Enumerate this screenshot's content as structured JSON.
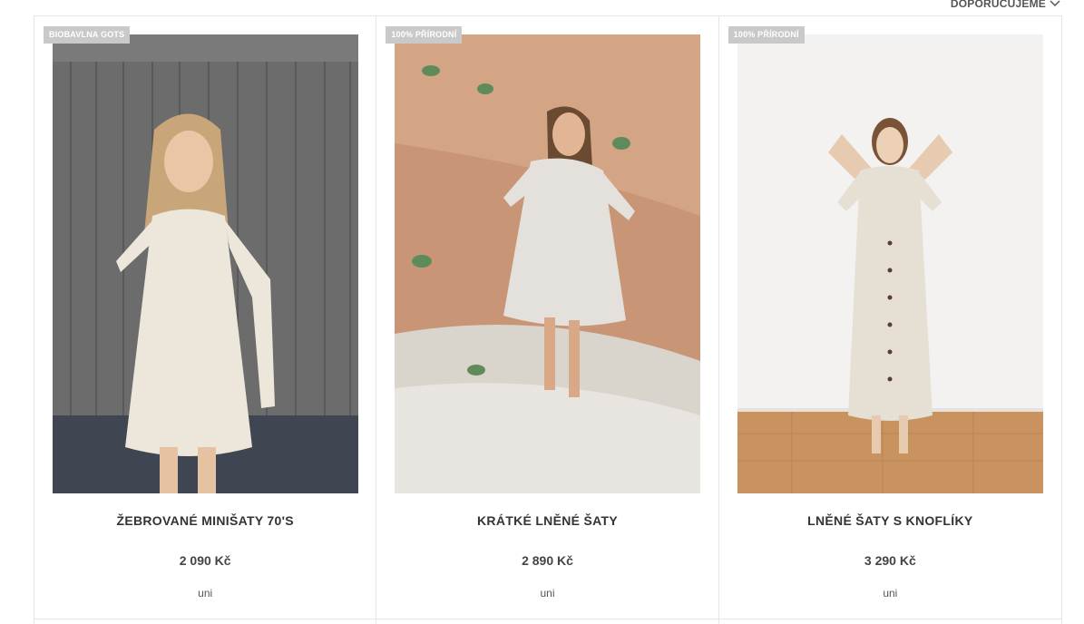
{
  "sort": {
    "label": "DOPORUČUJEME",
    "icon": "chevron-down-icon"
  },
  "products": [
    {
      "badge": "BIOBAVLNA GOTS",
      "name": "ŽEBROVANÉ MINIŠATY 70'S",
      "price": "2 090 Kč",
      "size": "uni"
    },
    {
      "badge": "100% PŘÍRODNÍ",
      "name": "KRÁTKÉ LNĚNÉ ŠATY",
      "price": "2 890 Kč",
      "size": "uni"
    },
    {
      "badge": "100% PŘÍRODNÍ",
      "name": "LNĚNÉ ŠATY S KNOFLÍKY",
      "price": "3 290 Kč",
      "size": "uni"
    }
  ]
}
